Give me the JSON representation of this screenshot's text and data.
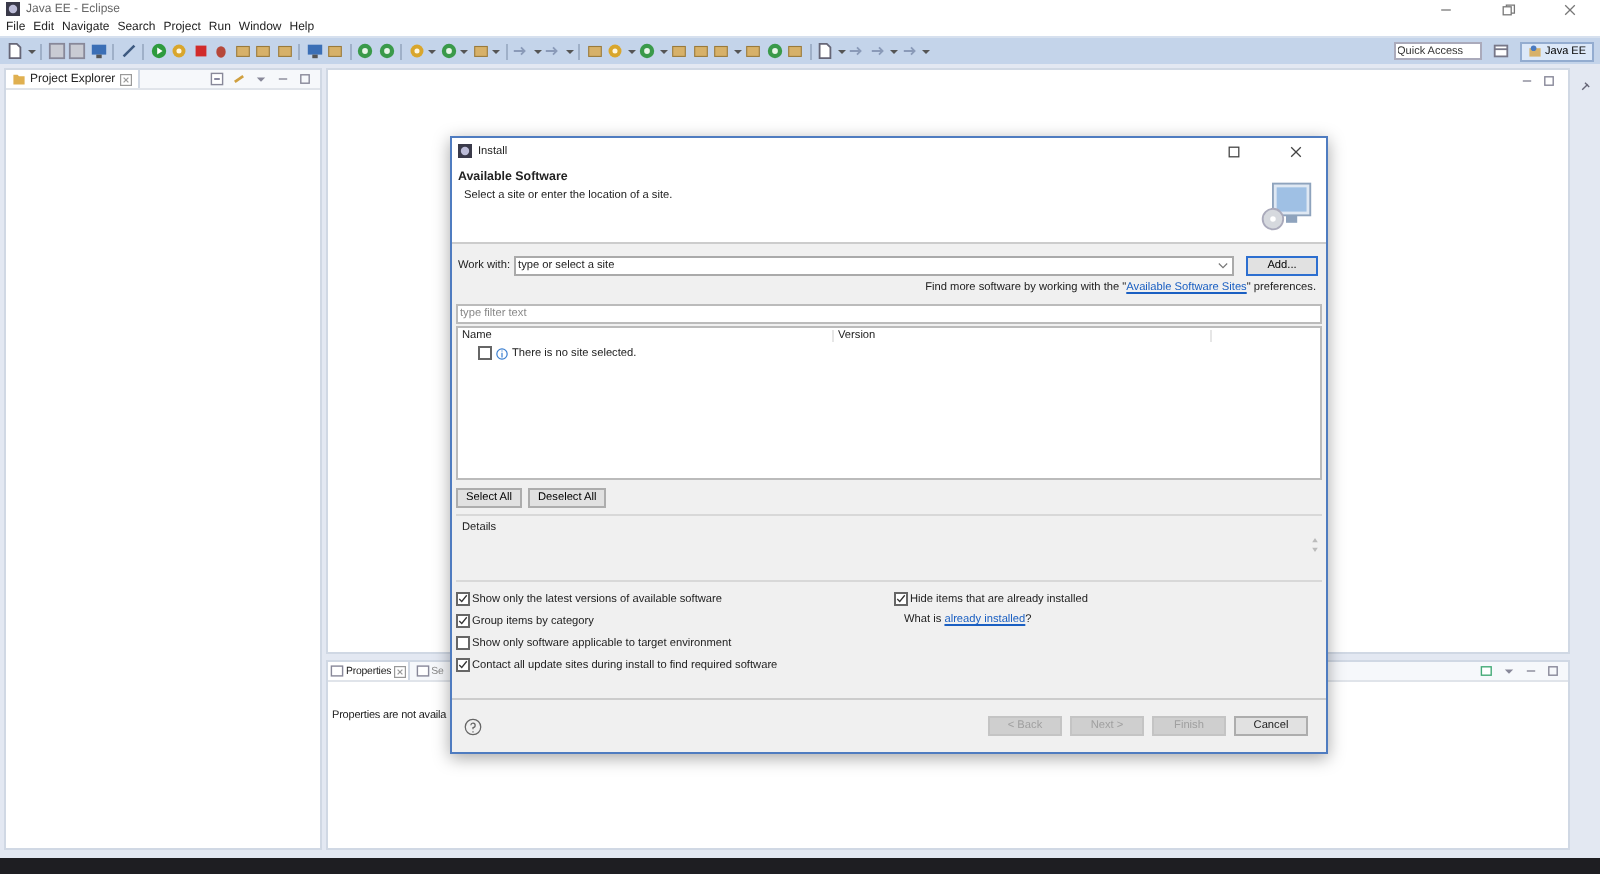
{
  "window": {
    "title": "Java EE - Eclipse"
  },
  "menu": [
    "File",
    "Edit",
    "Navigate",
    "Search",
    "Project",
    "Run",
    "Window",
    "Help"
  ],
  "quick_access": {
    "placeholder": "Quick Access"
  },
  "perspective": {
    "label": "Java EE",
    "selected": true
  },
  "project_explorer": {
    "title": "Project Explorer"
  },
  "bottom_panel": {
    "tabs": [
      {
        "label": "Properties",
        "selected": true
      },
      {
        "label": "Se",
        "selected": false
      }
    ],
    "message": "Properties are not availa"
  },
  "dialog": {
    "title": "Install",
    "heading": "Available Software",
    "subtitle": "Select a site or enter the location of a site.",
    "work_with": {
      "label": "Work with:",
      "placeholder": "type or select a site",
      "button": "Add..."
    },
    "find_more": {
      "before": "Find more software by working with the \"",
      "link": "Available Software Sites",
      "after": "\" preferences."
    },
    "filter": {
      "placeholder": "type filter text"
    },
    "columns": [
      "Name",
      "Version"
    ],
    "rows": [
      {
        "text": "There is no site selected.",
        "checked": false
      }
    ],
    "list_buttons": [
      "Select All",
      "Deselect All"
    ],
    "details": {
      "label": "Details"
    },
    "options": [
      {
        "label": "Show only the latest versions of available software",
        "checked": true
      },
      {
        "label": "Group items by category",
        "checked": true
      },
      {
        "label": "Show only software applicable to target environment",
        "checked": false
      },
      {
        "label": "Contact all update sites during install to find required software",
        "checked": true
      }
    ],
    "hide_installed": {
      "label": "Hide items that are already installed",
      "checked": true
    },
    "what_is": {
      "before": "What is ",
      "link": "already installed",
      "after": "?"
    },
    "footer_buttons": [
      {
        "label": "< Back",
        "disabled": true
      },
      {
        "label": "Next >",
        "disabled": true
      },
      {
        "label": "Finish",
        "disabled": true
      },
      {
        "label": "Cancel",
        "disabled": false
      }
    ]
  }
}
